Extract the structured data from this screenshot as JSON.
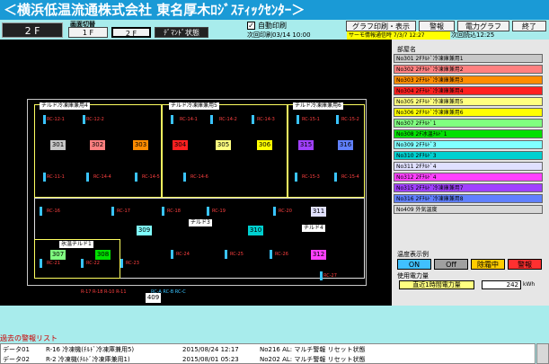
{
  "window": {
    "title": "＜横浜低温流通株式会社 東名厚木ﾛｼﾞｽﾃｨｯｸｾﾝﾀｰ＞"
  },
  "toolbar": {
    "current_floor": "2 F",
    "view_switch_label": "画面切替",
    "floor_buttons": [
      "1 F",
      "2 F"
    ],
    "demand_button": "ﾃﾞﾏﾝﾄﾞ状態",
    "auto_print_label": "自動印刷",
    "next_print": "次回印刷03/14 10:00",
    "graph_print_button": "グラフ印刷・表示",
    "alarm_button": "警報",
    "power_graph_button": "電力グラフ",
    "exit_button": "終了",
    "thermo_info": "サーモ情報通信時 7/3/7 12:27",
    "next_read": "次回読込12:25"
  },
  "legend": {
    "header": "部屋名",
    "items": [
      {
        "label": "No301 2Fﾁﾙﾄﾞ冷凍庫兼用1",
        "color": "#c8c8c8"
      },
      {
        "label": "No302 2Fﾁﾙﾄﾞ冷凍庫兼用2",
        "color": "#ff8080"
      },
      {
        "label": "No303 2Fﾁﾙﾄﾞ冷凍庫兼用3",
        "color": "#ff8c00"
      },
      {
        "label": "No304 2Fﾁﾙﾄﾞ冷凍庫兼用4",
        "color": "#ff2020"
      },
      {
        "label": "No305 2Fﾁﾙﾄﾞ冷凍庫兼用5",
        "color": "#ffff80"
      },
      {
        "label": "No306 2Fﾁﾙﾄﾞ冷凍庫兼用6",
        "color": "#ffff00"
      },
      {
        "label": "No307 2Fﾁﾙﾄﾞ1",
        "color": "#80ff80"
      },
      {
        "label": "No308 2F冰温ﾁﾙﾄﾞ1",
        "color": "#00e000"
      },
      {
        "label": "No309 2Fﾁﾙﾄﾞ3",
        "color": "#80ffff"
      },
      {
        "label": "No310 2Fﾁﾙﾄﾞ3",
        "color": "#00d0d0"
      },
      {
        "label": "No311 2Fﾁﾙﾄﾞ4",
        "color": "#e0e0ff"
      },
      {
        "label": "No312 2Fﾁﾙﾄﾞ4",
        "color": "#ff40ff"
      },
      {
        "label": "No315 2Fﾁﾙﾄﾞ冷凍庫兼用7",
        "color": "#a040ff"
      },
      {
        "label": "No316 2Fﾁﾙﾄﾞ冷凍庫兼用8",
        "color": "#6080ff"
      },
      {
        "label": "No409 外気温度",
        "color": "#d8d8d8"
      }
    ]
  },
  "temp_display": {
    "label": "温度表示例",
    "states": [
      {
        "label": "ON",
        "bg": "#40c0ff",
        "fg": "#000"
      },
      {
        "label": "Off",
        "bg": "#a0a0a0",
        "fg": "#000"
      },
      {
        "label": "除霜中",
        "bg": "#ffcc00",
        "fg": "#000"
      },
      {
        "label": "警報",
        "bg": "#ff3030",
        "fg": "#000"
      }
    ]
  },
  "power": {
    "label": "使用電力量",
    "recent_label": "直近1時間電力量",
    "value": "242",
    "unit": "kWh"
  },
  "floor_map": {
    "zone_labels": {
      "z4": "チルド冷凍庫兼用4",
      "z5": "チルド冷凍庫兼用5",
      "z6": "チルド冷凍庫兼用6",
      "chiru3": "チルド3",
      "chiru4": "チルド4",
      "hyo1": "氷温チルド1"
    },
    "rooms": [
      {
        "id": "301",
        "color": "#c8c8c8"
      },
      {
        "id": "302",
        "color": "#ff8080"
      },
      {
        "id": "303",
        "color": "#ff8c00"
      },
      {
        "id": "304",
        "color": "#ff2020"
      },
      {
        "id": "305",
        "color": "#ffff80"
      },
      {
        "id": "306",
        "color": "#ffff00"
      },
      {
        "id": "315",
        "color": "#a040ff"
      },
      {
        "id": "316",
        "color": "#6080ff"
      },
      {
        "id": "309",
        "color": "#80ffff"
      },
      {
        "id": "310",
        "color": "#00d0d0"
      },
      {
        "id": "311",
        "color": "#e0e0ff"
      },
      {
        "id": "312",
        "color": "#ff40ff"
      },
      {
        "id": "307",
        "color": "#80ff80"
      },
      {
        "id": "308",
        "color": "#00e000"
      },
      {
        "id": "409",
        "color": "#ffffff"
      }
    ],
    "tags": [
      "RC-12-1",
      "RC-12-2",
      "RC-14-1",
      "RC-14-2",
      "RC-14-3",
      "RC-15-1",
      "RC-15-2",
      "RC-11-1",
      "RC-14-4",
      "RC-14-5",
      "RC-14-6",
      "RC-15-3",
      "RC-15-4",
      "RC-16",
      "RC-17",
      "RC-18",
      "RC-19",
      "RC-20",
      "RC-21",
      "RC-22",
      "RC-23",
      "RC-24",
      "RC-25",
      "RC-26",
      "RC-27"
    ],
    "bottom_tags": "R-17 R-18 R-10 R-11",
    "bottom_tags2": "RC-A RC-B RC-C"
  },
  "alarms": {
    "header": "過去の警報リスト",
    "rows": [
      {
        "id": "データ01",
        "unit": "R-16 冷凍機(ﾁﾙﾄﾞ冷凍庫兼用5)",
        "date": "2015/08/24 12:17",
        "code": "No216 AL: マルチ警報 リセット状態"
      },
      {
        "id": "データ02",
        "unit": "R-2 冷凍機(ﾁﾙﾄﾞ冷凍庫兼用1)",
        "date": "2015/08/01 05:23",
        "code": "No202 AL: マルチ警報 リセット状態"
      }
    ]
  }
}
